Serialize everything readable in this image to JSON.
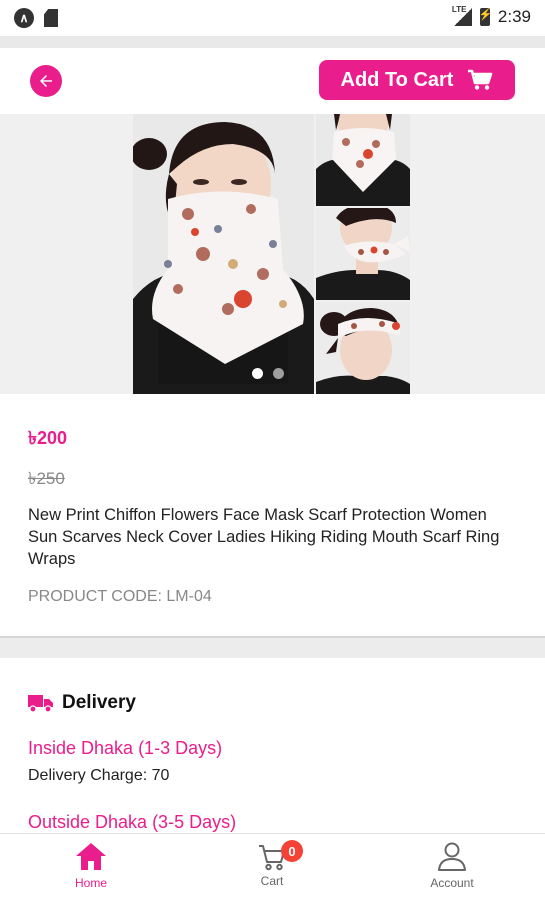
{
  "status_bar": {
    "time": "2:39",
    "network": "LTE"
  },
  "header": {
    "add_to_cart_label": "Add To Cart"
  },
  "gallery": {
    "image_count": 2,
    "active_index": 0
  },
  "product": {
    "price": "৳200",
    "old_price": "৳250",
    "title": "New Print Chiffon Flowers Face Mask Scarf Protection Women Sun Scarves Neck Cover Ladies Hiking Riding Mouth Scarf Ring Wraps",
    "code": "PRODUCT CODE: LM-04"
  },
  "delivery": {
    "heading": "Delivery",
    "zones": [
      {
        "title": "Inside Dhaka (1-3 Days)",
        "charge": "Delivery Charge: 70"
      },
      {
        "title": "Outside Dhaka (3-5 Days)"
      }
    ]
  },
  "bottom_nav": {
    "items": [
      {
        "label": "Home",
        "icon": "home-icon",
        "active": true
      },
      {
        "label": "Cart",
        "icon": "cart-icon",
        "badge": "0"
      },
      {
        "label": "Account",
        "icon": "account-icon"
      }
    ]
  },
  "colors": {
    "accent": "#e91e8c",
    "badge": "#f44336",
    "inactive": "#666666"
  }
}
